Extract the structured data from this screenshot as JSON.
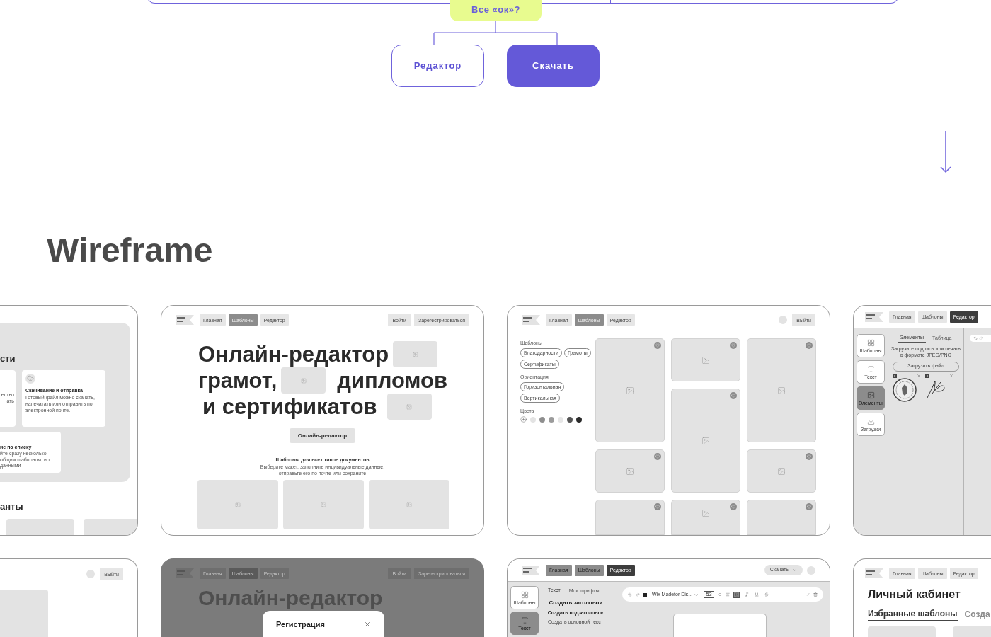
{
  "flowchart": {
    "decision": "Все «ок»?",
    "options": [
      {
        "label": "Редактор",
        "kind": "outline"
      },
      {
        "label": "Скачать",
        "kind": "filled"
      }
    ]
  },
  "section_title": "Wireframe",
  "wireframes_row_1": [
    {
      "kind": "features",
      "heading": "сти",
      "features": [
        {
          "lines": [
            "ество",
            "ать"
          ]
        },
        {
          "title": "Скачивание и отправка",
          "lines": [
            "Готовый файл можно скачать,",
            "напечатать или отправить по",
            "электронной почте."
          ]
        },
        {
          "title": "ие по списку",
          "lines": [
            "йте сразу несколько",
            "общим шаблоном, но",
            "данными"
          ]
        }
      ],
      "footer_heading": "анты"
    },
    {
      "kind": "home",
      "nav": [
        {
          "label": "Главная",
          "selected": false
        },
        {
          "label": "Шаблоны",
          "selected": true
        },
        {
          "label": "Редактор",
          "selected": false
        }
      ],
      "auth": [
        "Войти",
        "Зарегестрироваться"
      ],
      "headline": [
        [
          {
            "kind": "text",
            "text": "Онлайн-редактор"
          },
          {
            "kind": "image"
          }
        ],
        [
          {
            "kind": "text",
            "text": "грамот,"
          },
          {
            "kind": "image"
          },
          {
            "kind": "text",
            "text": "дипломов"
          }
        ],
        [
          {
            "kind": "text",
            "text": "и сертификатов"
          },
          {
            "kind": "image"
          }
        ]
      ],
      "cta": "Онлайн-редактор",
      "subtitle": "Шаблоны для всех типов документов",
      "description": [
        "Выберите макет, заполните индивидуальные данные,",
        "отправьте его по почте или сохраните"
      ]
    },
    {
      "kind": "catalog",
      "nav": [
        {
          "label": "Главная",
          "selected": false
        },
        {
          "label": "Шаблоны",
          "selected": true
        },
        {
          "label": "Редактор",
          "selected": false
        }
      ],
      "account_button": "Выйти",
      "filters": [
        {
          "title": "Шаблоны",
          "chips": [
            "Благодарности",
            "Грамоты",
            "Сертификаты"
          ]
        },
        {
          "title": "Ориентация",
          "chips": [
            "Горизонтальная",
            "Вертикальная"
          ]
        }
      ],
      "colors_title": "Цвета",
      "colors": [
        {
          "color": "#e3e3e3"
        },
        {
          "color": "#8e8e8e"
        },
        {
          "color": "#9b9b9b"
        },
        {
          "color": "#e6e6e6"
        },
        {
          "color": "#555555"
        },
        {
          "color": "#2a2a2a"
        }
      ],
      "template_columns": [
        [
          {
            "kind": "tall"
          },
          {
            "kind": "short"
          },
          {
            "kind": "cut"
          }
        ],
        [
          {
            "kind": "short"
          },
          {
            "kind": "tall"
          },
          {
            "kind": "cut_image"
          }
        ],
        [
          {
            "kind": "tall"
          },
          {
            "kind": "short"
          },
          {
            "kind": "cut"
          }
        ]
      ]
    },
    {
      "kind": "editor_elements",
      "nav": [
        {
          "label": "Главная",
          "selected": false
        },
        {
          "label": "Шаблоны",
          "selected": false
        },
        {
          "label": "Редактор",
          "selected": true
        }
      ],
      "tools": [
        {
          "kind": "templates",
          "label": "Шаблоны",
          "selected": false
        },
        {
          "kind": "text",
          "label": "Текст",
          "selected": false
        },
        {
          "kind": "elements",
          "label": "Элементы",
          "selected": true
        },
        {
          "kind": "downloads",
          "label": "Загрузки",
          "selected": false
        }
      ],
      "panel_tabs": [
        {
          "label": "Элементы",
          "selected": true
        },
        {
          "label": "Таблица",
          "selected": false
        }
      ],
      "hint": [
        "Загрузите подпись или печать",
        "в формате JPEG/PNG"
      ],
      "upload_button": "Загрузить файл",
      "uploads": [
        {
          "kind": "stamp",
          "checked": true
        },
        {
          "kind": "signature",
          "checked": true
        }
      ]
    }
  ],
  "wireframes_row_2": [
    {
      "kind": "profile",
      "account_button": "Выйти"
    },
    {
      "kind": "home_modal",
      "nav": [
        {
          "label": "Главная",
          "selected": false
        },
        {
          "label": "Шаблоны",
          "selected": true
        },
        {
          "label": "Редактор",
          "selected": false
        }
      ],
      "auth": [
        "Войти",
        "Зарегестрироваться"
      ],
      "headline": "Онлайн-редактор",
      "modal": {
        "title": "Регистрация"
      }
    },
    {
      "kind": "editor_text",
      "nav": [
        {
          "label": "Главная",
          "selected": false
        },
        {
          "label": "Шаблоны",
          "selected": false
        },
        {
          "label": "Редактор",
          "selected": true
        }
      ],
      "download_button": "Скачать",
      "tools": [
        {
          "kind": "templates",
          "label": "Шаблоны",
          "selected": false
        },
        {
          "kind": "text",
          "label": "Текст",
          "selected": true
        }
      ],
      "panel_tabs": [
        {
          "label": "Текст",
          "selected": true
        },
        {
          "label": "Мои шрифты",
          "selected": false
        }
      ],
      "text_styles": [
        {
          "kind": "heading",
          "label": "Создать заголовок"
        },
        {
          "kind": "subheading",
          "label": "Создать подзаголовок"
        },
        {
          "kind": "body",
          "label": "Создать основной текст"
        }
      ],
      "toolbar": {
        "font": "Wix Madefor Dis...",
        "size": "53",
        "formats": [
          {
            "kind": "bold",
            "selected": true
          },
          {
            "kind": "italic",
            "selected": false
          },
          {
            "kind": "underline",
            "selected": false
          },
          {
            "kind": "strike",
            "selected": false
          }
        ]
      }
    },
    {
      "kind": "cabinet",
      "nav": [
        {
          "label": "Главная",
          "selected": false
        },
        {
          "label": "Шаблоны",
          "selected": false
        },
        {
          "label": "Редактор",
          "selected": false
        }
      ],
      "title": "Личный кабинет",
      "tabs": [
        {
          "label": "Избранные шаблоны",
          "selected": true
        },
        {
          "label": "Созда",
          "selected": false
        }
      ]
    }
  ]
}
